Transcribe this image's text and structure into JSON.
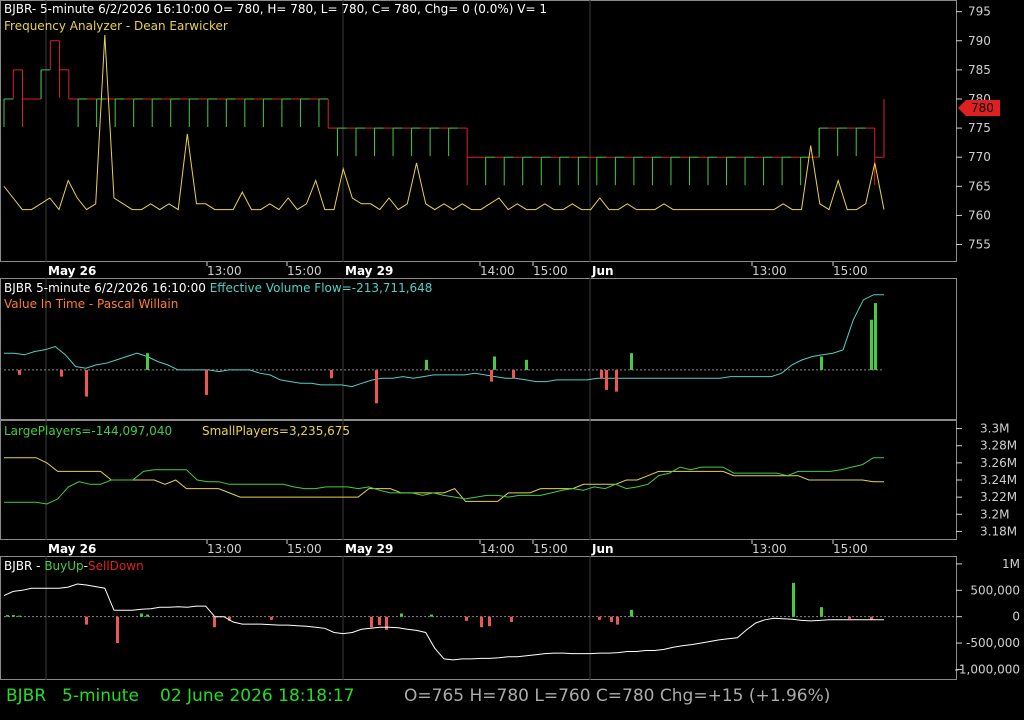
{
  "colors": {
    "bg": "#000000",
    "grid": "#3a3a3a",
    "axis": "#cfcfcf",
    "white": "#ffffff",
    "red": "#dd2222",
    "green": "#44cc44",
    "yellow": "#e8d24a",
    "cyan": "#4fd0c8",
    "orange": "#ff7f2a",
    "pink": "#ee5555",
    "brightgreen": "#22dd22"
  },
  "x_axis": {
    "dates": [
      {
        "label": "May 26"
      },
      {
        "label": "May 29"
      },
      {
        "label": "Jun"
      }
    ],
    "times": [
      {
        "label": "13:00"
      },
      {
        "label": "15:00"
      },
      {
        "label": "14:00"
      },
      {
        "label": "15:00"
      },
      {
        "label": "13:00"
      },
      {
        "label": "15:00"
      }
    ]
  },
  "price_panel": {
    "header": "BJBR- 5-minute 6/2/2026 16:10:00 O= 780, H= 780, L= 780, C= 780, Chg= 0 (0.0%) V= 1",
    "indicator_label": "Frequency Analyzer - Dean Earwicker",
    "last_price_label": "780",
    "y_ticks": [
      "795",
      "790",
      "785",
      "780",
      "775",
      "770",
      "765",
      "760",
      "755"
    ]
  },
  "flow_panel": {
    "header_prefix": "BJBR 5-minute  6/2/2026 16:10:00 ",
    "header_value": "Effective Volume Flow=-213,711,648",
    "indicator_label": "Value In Time - Pascal Willain"
  },
  "players_panel": {
    "large_label": "LargePlayers=-144,097,040",
    "small_label": "SmallPlayers=3,235,675",
    "y_ticks": [
      "3.3M",
      "3.28M",
      "3.26M",
      "3.24M",
      "3.22M",
      "3.2M",
      "3.18M"
    ]
  },
  "buysell_panel": {
    "prefix": "BJBR - ",
    "buy_label": "BuyUp",
    "sep": "-",
    "sell_label": "SellDown",
    "y_ticks": [
      "1M",
      "500,000",
      "0",
      "-500,000",
      "-1,000,000"
    ]
  },
  "status_bar": {
    "symbol": "BJBR",
    "interval": "5-minute",
    "datetime": "02 June 2026 18:18:17",
    "ohlc": "O=765  H=780  L=760  C=780  Chg=+15 (+1.96%)"
  },
  "chart_data": [
    {
      "type": "line",
      "name": "price",
      "title": "BJBR 5-minute",
      "ylim": [
        752,
        797
      ],
      "series": [
        {
          "values": [
            780,
            785,
            780,
            780,
            785,
            790,
            785,
            780,
            780,
            780,
            780,
            780,
            780,
            780,
            780,
            780,
            780,
            780,
            780,
            780,
            780,
            780,
            780,
            780,
            780,
            780,
            780,
            780,
            780,
            780,
            780,
            780,
            780,
            780,
            780,
            775,
            775,
            775,
            775,
            775,
            775,
            775,
            775,
            775,
            775,
            775,
            775,
            775,
            775,
            775,
            770,
            770,
            770,
            770,
            770,
            770,
            770,
            770,
            770,
            770,
            770,
            770,
            770,
            770,
            770,
            770,
            770,
            770,
            770,
            770,
            770,
            770,
            770,
            770,
            770,
            770,
            770,
            770,
            770,
            770,
            770,
            770,
            770,
            770,
            770,
            770,
            770,
            770,
            775,
            775,
            775,
            775,
            775,
            775,
            770,
            780
          ]
        }
      ]
    },
    {
      "type": "line",
      "name": "frequency_analyzer",
      "ylim": [
        752,
        797
      ],
      "series": [
        {
          "values": [
            765,
            763,
            761,
            761,
            762,
            763,
            761,
            766,
            763,
            761,
            762,
            791,
            763,
            762,
            761,
            761,
            762,
            761,
            762,
            761,
            774,
            762,
            762,
            761,
            761,
            761,
            764,
            761,
            761,
            762,
            761,
            763,
            761,
            762,
            766,
            761,
            761,
            768,
            763,
            762,
            762,
            761,
            763,
            761,
            762,
            769,
            762,
            761,
            762,
            761,
            762,
            761,
            761,
            762,
            763,
            761,
            762,
            761,
            761,
            762,
            761,
            761,
            762,
            761,
            761,
            763,
            761,
            761,
            762,
            761,
            761,
            761,
            762,
            761,
            761,
            761,
            761,
            761,
            761,
            761,
            761,
            761,
            761,
            761,
            761,
            762,
            761,
            761,
            772,
            762,
            761,
            766,
            761,
            761,
            762,
            769,
            761
          ]
        }
      ]
    },
    {
      "type": "line",
      "name": "effective_volume_flow",
      "ylim": [
        -30,
        55
      ],
      "series": [
        {
          "values": [
            10,
            10,
            9,
            11,
            12,
            14,
            9,
            2,
            1,
            3,
            4,
            6,
            8,
            10,
            8,
            5,
            3,
            0,
            0,
            0,
            0,
            -1,
            0,
            0,
            0,
            -2,
            -3,
            -6,
            -7,
            -8,
            -8,
            -9,
            -9,
            -9,
            -10,
            -8,
            -6,
            -5,
            -5,
            -4,
            -5,
            -4,
            -3,
            -3,
            -3,
            -3,
            -2,
            -3,
            -4,
            -5,
            -5,
            -6,
            -7,
            -7,
            -6,
            -6,
            -6,
            -6,
            -5,
            -5,
            -5,
            -5,
            -5,
            -5,
            -5,
            -5,
            -5,
            -5,
            -5,
            -5,
            -5,
            -4,
            -4,
            -4,
            -4,
            -4,
            -2,
            3,
            6,
            8,
            9,
            10,
            12,
            30,
            42,
            45,
            45
          ]
        }
      ]
    },
    {
      "type": "line",
      "name": "LargePlayers",
      "ylim": [
        3.17,
        3.31
      ],
      "series": [
        {
          "values": [
            3.266,
            3.266,
            3.266,
            3.266,
            3.26,
            3.25,
            3.25,
            3.25,
            3.25,
            3.25,
            3.24,
            3.24,
            3.24,
            3.24,
            3.24,
            3.235,
            3.24,
            3.23,
            3.23,
            3.23,
            3.23,
            3.225,
            3.22,
            3.22,
            3.22,
            3.22,
            3.22,
            3.22,
            3.22,
            3.22,
            3.22,
            3.22,
            3.22,
            3.22,
            3.23,
            3.23,
            3.23,
            3.225,
            3.225,
            3.225,
            3.225,
            3.225,
            3.23,
            3.215,
            3.215,
            3.215,
            3.215,
            3.225,
            3.225,
            3.225,
            3.23,
            3.23,
            3.23,
            3.23,
            3.235,
            3.235,
            3.235,
            3.235,
            3.24,
            3.24,
            3.245,
            3.25,
            3.25,
            3.25,
            3.25,
            3.25,
            3.25,
            3.25,
            3.245,
            3.245,
            3.245,
            3.245,
            3.245,
            3.245,
            3.245,
            3.24,
            3.24,
            3.24,
            3.24,
            3.24,
            3.24,
            3.238,
            3.238
          ]
        }
      ]
    },
    {
      "type": "line",
      "name": "SmallPlayers",
      "ylim": [
        3.17,
        3.31
      ],
      "series": [
        {
          "values": [
            3.214,
            3.214,
            3.214,
            3.214,
            3.212,
            3.218,
            3.232,
            3.238,
            3.235,
            3.235,
            3.24,
            3.24,
            3.24,
            3.25,
            3.252,
            3.252,
            3.252,
            3.252,
            3.24,
            3.238,
            3.238,
            3.235,
            3.235,
            3.235,
            3.235,
            3.235,
            3.235,
            3.232,
            3.23,
            3.23,
            3.232,
            3.232,
            3.232,
            3.23,
            3.232,
            3.228,
            3.225,
            3.225,
            3.225,
            3.222,
            3.225,
            3.222,
            3.22,
            3.218,
            3.22,
            3.222,
            3.222,
            3.22,
            3.222,
            3.222,
            3.222,
            3.225,
            3.228,
            3.23,
            3.228,
            3.232,
            3.23,
            3.235,
            3.23,
            3.232,
            3.235,
            3.245,
            3.248,
            3.255,
            3.252,
            3.255,
            3.255,
            3.255,
            3.248,
            3.248,
            3.248,
            3.248,
            3.248,
            3.245,
            3.25,
            3.25,
            3.25,
            3.25,
            3.252,
            3.255,
            3.258,
            3.266,
            3.266
          ]
        }
      ]
    },
    {
      "type": "bar",
      "name": "buyup_selldown",
      "ylim": [
        -1200000,
        1150000
      ],
      "series": [
        {
          "name": "BuyUp",
          "values": [
            0,
            0,
            0,
            0,
            0,
            0,
            0,
            0,
            0,
            0,
            0,
            0,
            0,
            0,
            0,
            0,
            0,
            0,
            0,
            0,
            0,
            0,
            0,
            0,
            0,
            0,
            0,
            0,
            0,
            0,
            0,
            0,
            0,
            0,
            0,
            0,
            0,
            0,
            0,
            0,
            0,
            0,
            0,
            0,
            0,
            0,
            0,
            0,
            0,
            0,
            0,
            0,
            0,
            0,
            0,
            0,
            0,
            0,
            0,
            0,
            0,
            0,
            0,
            0,
            0,
            0,
            0,
            0,
            0,
            0,
            0,
            0,
            0,
            0,
            0,
            0,
            0,
            0,
            0,
            0,
            0,
            0,
            0,
            0,
            0,
            0,
            0,
            0,
            0,
            0,
            0,
            0,
            0,
            0,
            0,
            0,
            0
          ]
        },
        {
          "name": "SellDown",
          "values": [
            0
          ]
        }
      ]
    },
    {
      "type": "line",
      "name": "buysell_line",
      "ylim": [
        -1200000,
        1150000
      ],
      "series": [
        {
          "values": [
            400000,
            480000,
            500000,
            540000,
            540000,
            540000,
            540000,
            560000,
            620000,
            600000,
            570000,
            540000,
            120000,
            120000,
            120000,
            140000,
            150000,
            180000,
            180000,
            190000,
            180000,
            200000,
            200000,
            0,
            0,
            -100000,
            -140000,
            -140000,
            -140000,
            -150000,
            -160000,
            -160000,
            -170000,
            -180000,
            -200000,
            -220000,
            -300000,
            -320000,
            -300000,
            -240000,
            -220000,
            -200000,
            -200000,
            -210000,
            -240000,
            -260000,
            -300000,
            -600000,
            -800000,
            -820000,
            -800000,
            -800000,
            -790000,
            -790000,
            -780000,
            -760000,
            -760000,
            -740000,
            -720000,
            -700000,
            -690000,
            -690000,
            -700000,
            -700000,
            -700000,
            -690000,
            -690000,
            -680000,
            -660000,
            -660000,
            -640000,
            -640000,
            -620000,
            -580000,
            -550000,
            -530000,
            -500000,
            -470000,
            -440000,
            -420000,
            -400000,
            -250000,
            -120000,
            -60000,
            -30000,
            -40000,
            -50000,
            -70000,
            -80000,
            -70000,
            -60000,
            -60000,
            -60000,
            -60000,
            -60000,
            -60000,
            -60000
          ]
        }
      ]
    }
  ]
}
